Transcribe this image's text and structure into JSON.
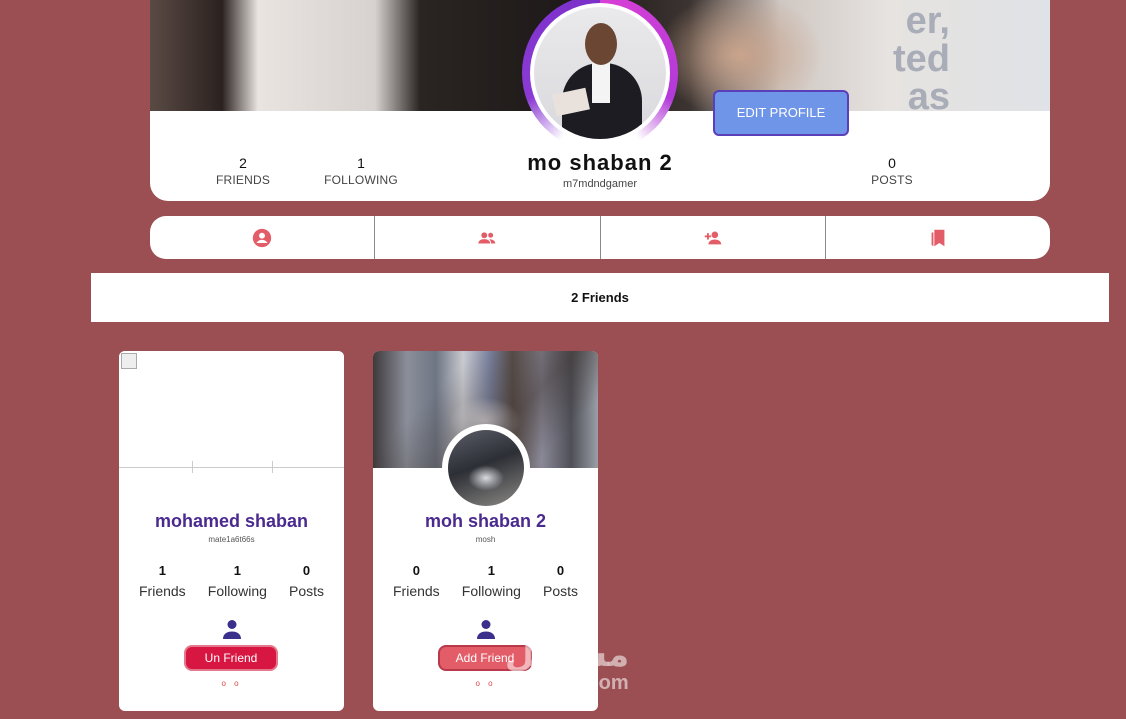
{
  "profile": {
    "name": "mo shaban 2",
    "handle": "m7mdndgamer",
    "edit_label": "EDIT PROFILE",
    "stats": {
      "friends": {
        "value": "2",
        "label": "FRIENDS"
      },
      "following": {
        "value": "1",
        "label": "FOLLOWING"
      },
      "posts": {
        "value": "0",
        "label": "POSTS"
      }
    },
    "ring_colors": [
      "#d93fd6",
      "#7a2fc9"
    ]
  },
  "tabs": [
    {
      "icon": "account-circle-icon"
    },
    {
      "icon": "group-icon"
    },
    {
      "icon": "person-add-icon"
    },
    {
      "icon": "bookmarks-icon"
    }
  ],
  "friends_count_label": "2 Friends",
  "friends": [
    {
      "name": "mohamed shaban",
      "handle": "mate1a6t66s",
      "stats": {
        "friends": "1",
        "following": "1",
        "posts": "0"
      },
      "labels": {
        "friends": "Friends",
        "following": "Following",
        "posts": "Posts"
      },
      "action": "Un Friend"
    },
    {
      "name": "moh shaban 2",
      "handle": "mosh",
      "stats": {
        "friends": "0",
        "following": "1",
        "posts": "0"
      },
      "labels": {
        "friends": "Friends",
        "following": "Following",
        "posts": "Posts"
      },
      "action": "Add Friend"
    }
  ],
  "pagination_dots": "o o",
  "watermark": {
    "arabic": "مستقل",
    "latin": "mostaql.com"
  },
  "colors": {
    "background": "#9b4f52",
    "accent_icon": "#e35d68",
    "name": "#4b2a8f",
    "unfriend": "#d71642",
    "edit": "#6f95e8"
  }
}
